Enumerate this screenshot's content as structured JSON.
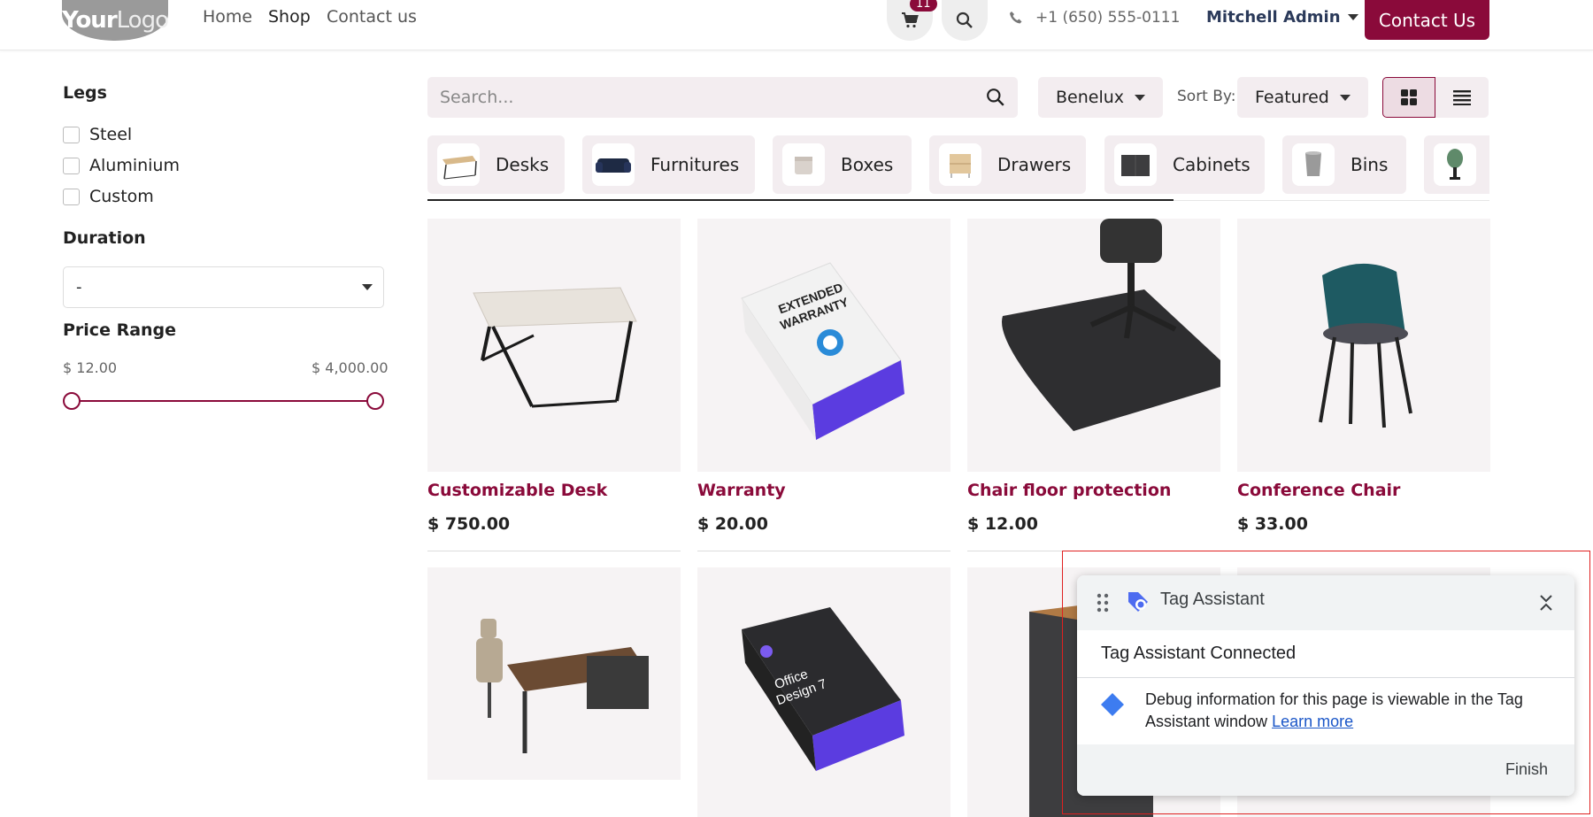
{
  "header": {
    "logo_bold": "Your",
    "logo_light": "Logo",
    "nav": [
      "Home",
      "Shop",
      "Contact us"
    ],
    "cart_count": "11",
    "phone": "+1 (650) 555-0111",
    "user": "Mitchell Admin",
    "contact_button": "Contact Us"
  },
  "sidebar": {
    "legs_title": "Legs",
    "legs_options": [
      "Steel",
      "Aluminium",
      "Custom"
    ],
    "duration_title": "Duration",
    "duration_value": "-",
    "price_title": "Price Range",
    "price_min": "$ 12.00",
    "price_max": "$ 4,000.00"
  },
  "toolbar": {
    "search_placeholder": "Search...",
    "pricelist": "Benelux",
    "sort_label": "Sort By:",
    "sort_value": "Featured"
  },
  "categories": [
    "Desks",
    "Furnitures",
    "Boxes",
    "Drawers",
    "Cabinets",
    "Bins"
  ],
  "products": [
    {
      "name": "Customizable Desk",
      "price": "$ 750.00"
    },
    {
      "name": "Warranty",
      "price": "$ 20.00"
    },
    {
      "name": "Chair floor protection",
      "price": "$ 12.00"
    },
    {
      "name": "Conference Chair",
      "price": "$ 33.00"
    }
  ],
  "product_images": {
    "warranty_line1": "EXTENDED",
    "warranty_line2": "WARRANTY",
    "office_line1": "Office",
    "office_line2": "Design 7"
  },
  "tag_assistant": {
    "title": "Tag Assistant",
    "connected": "Tag Assistant Connected",
    "message": "Debug information for this page is viewable in the Tag Assistant window",
    "link": "Learn more",
    "finish": "Finish"
  },
  "colors": {
    "brand": "#8a0a3a",
    "badge_bg": "#f3edf0"
  }
}
